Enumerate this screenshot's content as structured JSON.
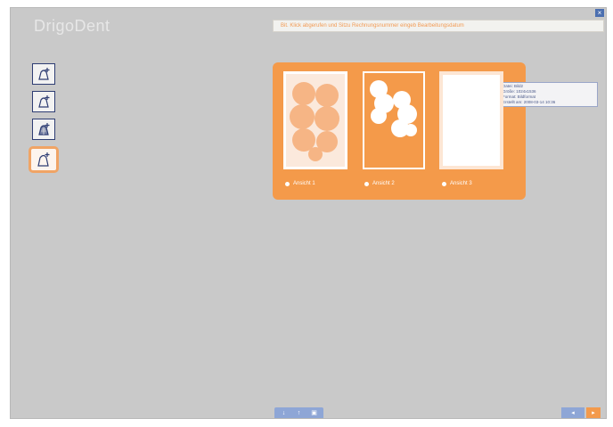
{
  "app": {
    "title": "DrigoDent",
    "close_glyph": "×"
  },
  "notice": {
    "text": "Bit. Klick abgerufen und Sitzu Rechnungsnummer eingeb Bearbeitungsdatum"
  },
  "sidebar": {
    "tools": [
      {
        "name": "tool-draw-1",
        "icon": "bell-plus-icon"
      },
      {
        "name": "tool-draw-2",
        "icon": "bell-plus-icon"
      },
      {
        "name": "tool-draw-3",
        "icon": "bell-grid-icon"
      },
      {
        "name": "tool-draw-4",
        "icon": "bell-plus-icon",
        "active": true
      }
    ]
  },
  "panel": {
    "thumbnails": [
      {
        "label": "Ansicht 1"
      },
      {
        "label": "Ansicht 2"
      },
      {
        "label": "Ansicht 3"
      }
    ],
    "tooltip": [
      "Datei: Bild2",
      "Größe: 1024x1536",
      "Format: Bildformat",
      "Erstellt am: 2008-03-14 10:36"
    ]
  },
  "bottom_toolbar": {
    "buttons": [
      "↓",
      "↑",
      "▣"
    ]
  },
  "nav": {
    "back": "◂",
    "forward": "▸"
  },
  "colors": {
    "accent": "#f49a4a",
    "background": "#c9c9c9",
    "toolbar_blue": "#8ea6d6"
  }
}
